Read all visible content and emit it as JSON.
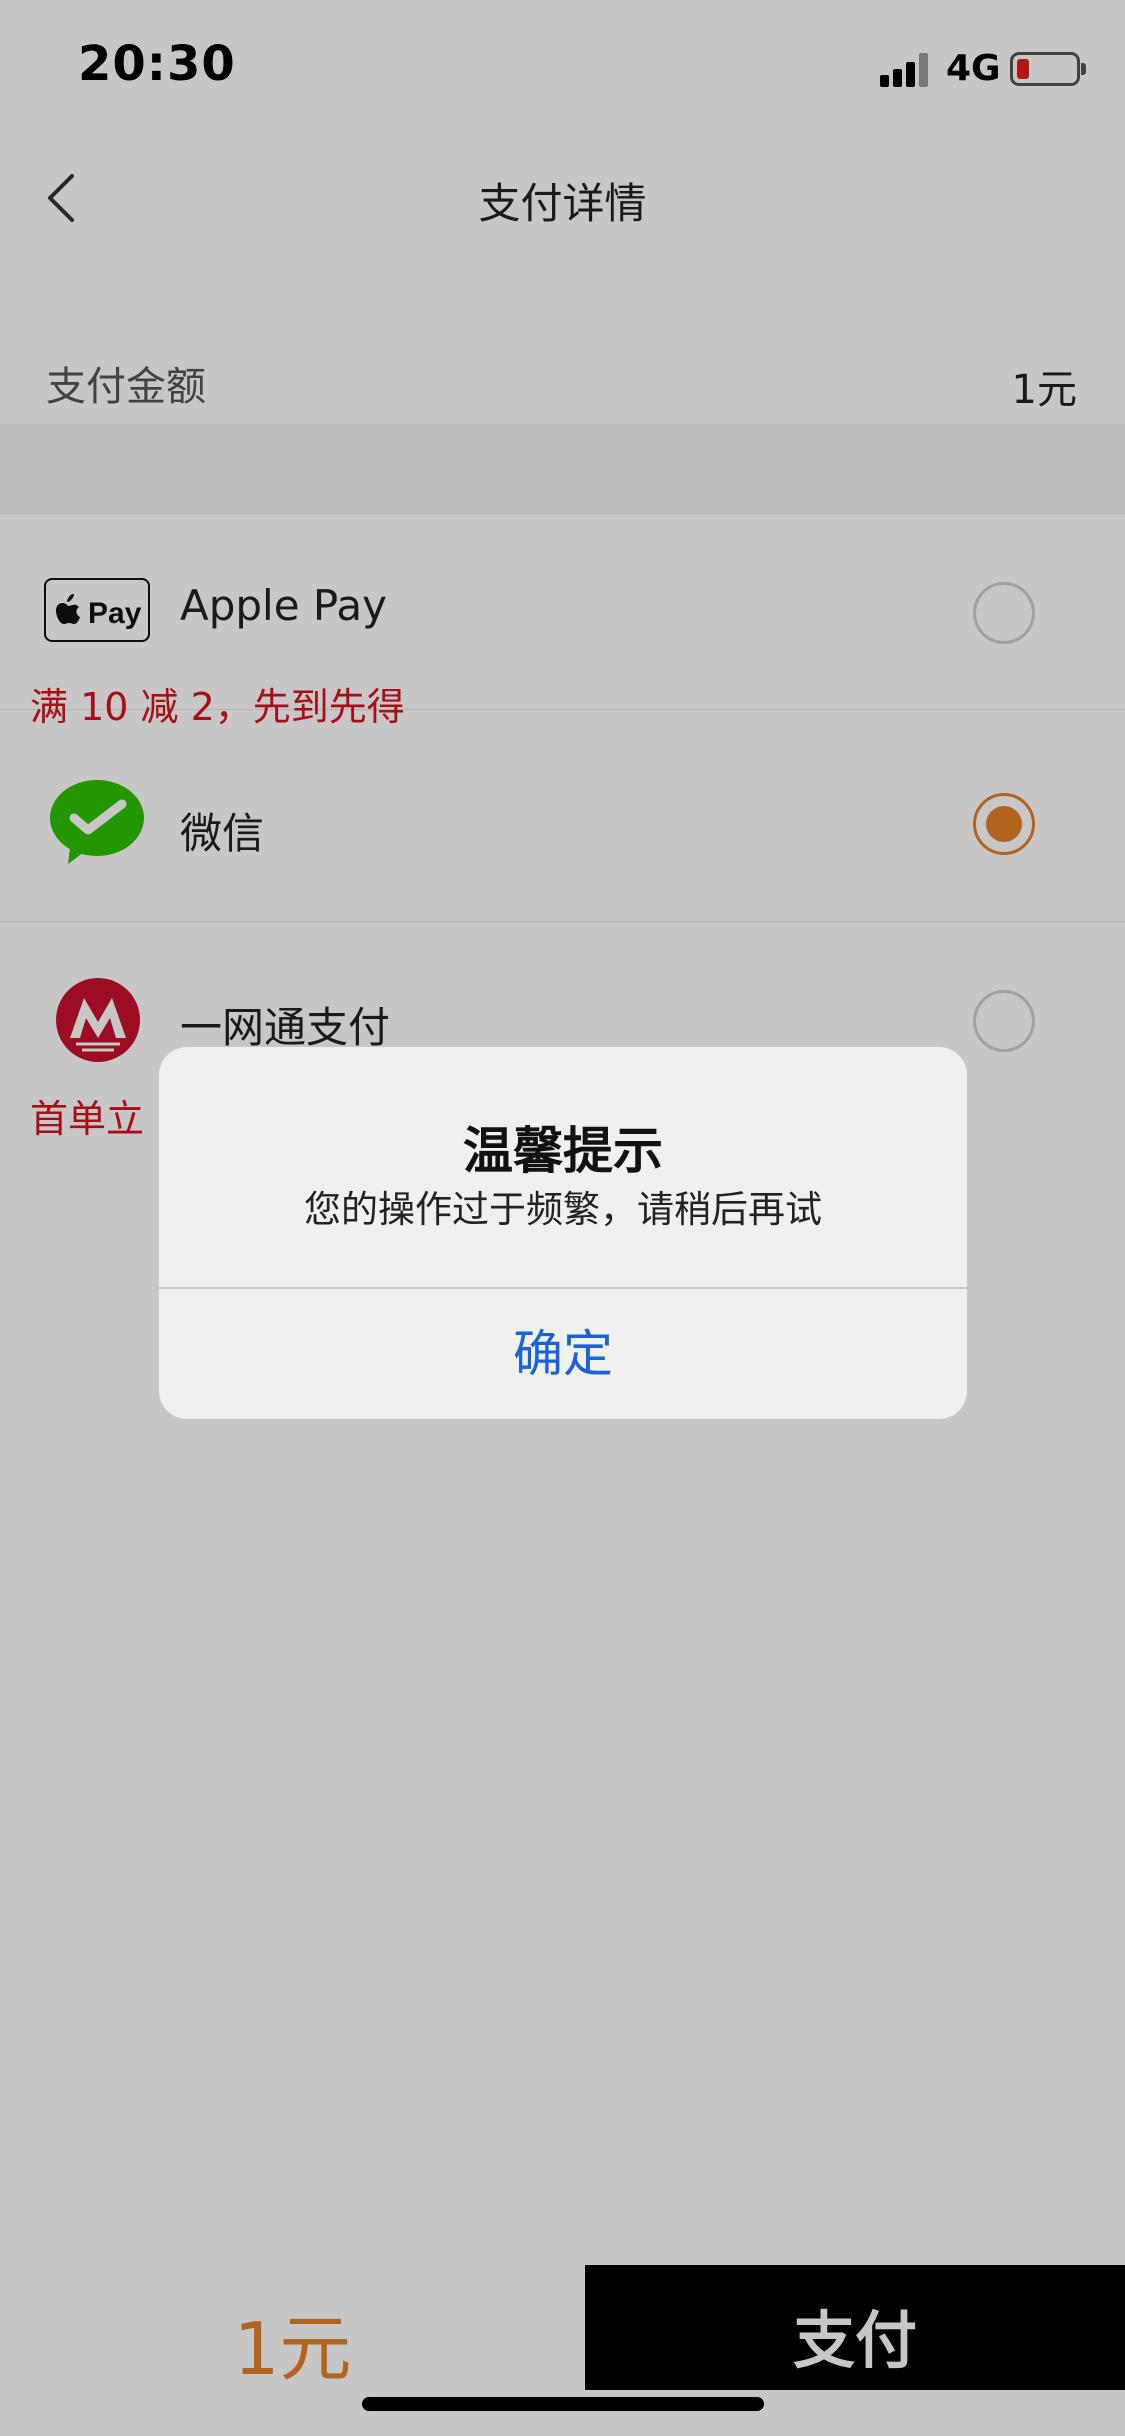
{
  "status_bar": {
    "time": "20:30",
    "network": "4G",
    "battery_level": 0.15
  },
  "nav": {
    "title": "支付详情",
    "back_icon": "chevron-left-icon"
  },
  "amount": {
    "label": "支付金额",
    "value": "1元"
  },
  "payment_methods": [
    {
      "name": "Apple Pay",
      "icon": "apple-pay-icon",
      "selected": false,
      "promo": "满 10 减 2，先到先得"
    },
    {
      "name": "微信",
      "icon": "wechat-pay-icon",
      "selected": true,
      "promo": ""
    },
    {
      "name": "一网通支付",
      "icon": "cmb-icon",
      "selected": false,
      "promo": "首单立"
    }
  ],
  "apple_pay_logo_text": "Pay",
  "bottom_bar": {
    "price": "1元",
    "pay_label": "支付"
  },
  "alert": {
    "title": "温馨提示",
    "message": "您的操作过于频繁，请稍后再试",
    "ok_label": "确定"
  },
  "colors": {
    "accent": "#e57f27",
    "promo": "#d7121b",
    "alert_button": "#1a63d6",
    "wechat_green": "#2dc100",
    "cmb_red": "#c8102e"
  }
}
